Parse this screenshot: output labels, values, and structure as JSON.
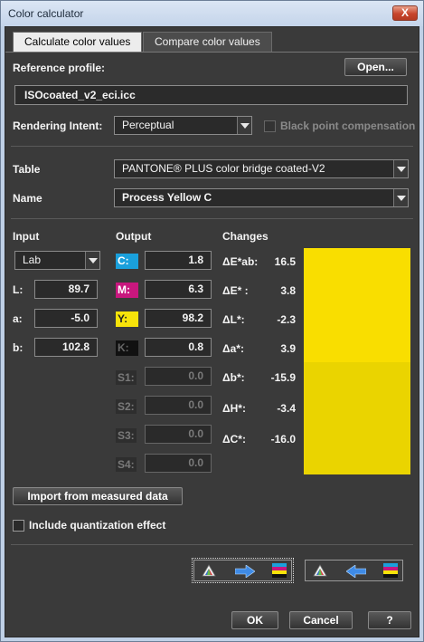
{
  "window": {
    "title": "Color calculator",
    "close_glyph": "X"
  },
  "tabs": [
    {
      "label": "Calculate color values",
      "active": true
    },
    {
      "label": "Compare color values",
      "active": false
    }
  ],
  "reference_profile": {
    "label": "Reference profile:",
    "open_button": "Open...",
    "value": "ISOcoated_v2_eci.icc"
  },
  "rendering_intent": {
    "label": "Rendering Intent:",
    "value": "Perceptual",
    "black_point_label": "Black point compensation",
    "black_point_checked": false
  },
  "table": {
    "label": "Table",
    "value": "PANTONE® PLUS color bridge coated-V2"
  },
  "name": {
    "label": "Name",
    "value": "Process Yellow C"
  },
  "input": {
    "header": "Input",
    "mode": "Lab",
    "rows": [
      {
        "label": "L:",
        "value": "89.7"
      },
      {
        "label": "a:",
        "value": "-5.0"
      },
      {
        "label": "b:",
        "value": "102.8"
      }
    ]
  },
  "output": {
    "header": "Output",
    "channels": [
      {
        "label": "C:",
        "value": "1.8",
        "color": "#1aa0dc",
        "enabled": true
      },
      {
        "label": "M:",
        "value": "6.3",
        "color": "#c8177e",
        "enabled": true
      },
      {
        "label": "Y:",
        "value": "98.2",
        "color": "#f7e30a",
        "enabled": true
      },
      {
        "label": "K:",
        "value": "0.8",
        "color": "#111111",
        "enabled": true
      },
      {
        "label": "S1:",
        "value": "0.0",
        "enabled": false
      },
      {
        "label": "S2:",
        "value": "0.0",
        "enabled": false
      },
      {
        "label": "S3:",
        "value": "0.0",
        "enabled": false
      },
      {
        "label": "S4:",
        "value": "0.0",
        "enabled": false
      }
    ]
  },
  "changes": {
    "header": "Changes",
    "rows": [
      {
        "label": "ΔE*ab:",
        "value": "16.5"
      },
      {
        "label": "ΔE* :",
        "value": "3.8"
      },
      {
        "label": "ΔL*:",
        "value": "-2.3"
      },
      {
        "label": "Δa*:",
        "value": "3.9"
      },
      {
        "label": "Δb*:",
        "value": "-15.9"
      },
      {
        "label": "ΔH*:",
        "value": "-3.4"
      },
      {
        "label": "ΔC*:",
        "value": "-16.0"
      }
    ],
    "swatch_reference_color": "#f9de00",
    "swatch_result_color": "#ead400"
  },
  "import_button": "Import from measured data",
  "quantization": {
    "label": "Include quantization effect",
    "checked": false
  },
  "conversion_buttons": [
    {
      "icon": "lab-to-cmyk-icon",
      "focused": true
    },
    {
      "icon": "cmyk-to-lab-icon",
      "focused": false
    }
  ],
  "footer": {
    "ok": "OK",
    "cancel": "Cancel",
    "help": "?"
  }
}
